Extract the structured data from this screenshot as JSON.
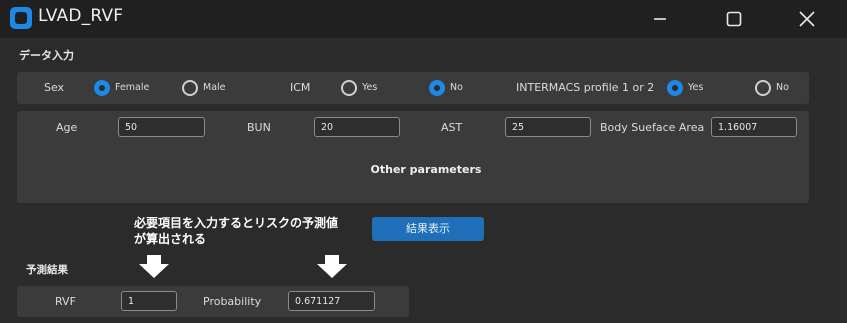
{
  "window": {
    "title": "LVAD_RVF",
    "controls": [
      "minimize-icon",
      "maximize-icon",
      "close-icon"
    ]
  },
  "input_section": {
    "label": "データ入力"
  },
  "sex": {
    "label": "Sex",
    "options": [
      "Female",
      "Male"
    ],
    "selected": "Female"
  },
  "icm": {
    "label": "ICM",
    "options": [
      "Yes",
      "No"
    ],
    "selected": "No"
  },
  "intermacs": {
    "label": "INTERMACS profile 1 or 2",
    "options": [
      "Yes",
      "No"
    ],
    "selected": "Yes"
  },
  "params": {
    "age": {
      "label": "Age",
      "value": "50"
    },
    "bun": {
      "label": "BUN",
      "value": "20"
    },
    "ast": {
      "label": "AST",
      "value": "25"
    },
    "bsa": {
      "label": "Body Sueface Area",
      "value": "1.16007"
    },
    "other_label": "Other parameters"
  },
  "annotation": {
    "line1": "必要項目を入力するとリスクの予測値",
    "line2": "が算出される"
  },
  "show_result_button": {
    "label": "結果表示"
  },
  "result_section": {
    "label": "予測結果",
    "rvf": {
      "label": "RVF",
      "value": "1"
    },
    "probability": {
      "label": "Probability",
      "value": "0.671127"
    }
  },
  "colors": {
    "accent": "#1e88e5",
    "button": "#1e6fb8",
    "background": "#2b2b2b",
    "panel": "#3b3b3b",
    "titlebar": "#202020"
  }
}
